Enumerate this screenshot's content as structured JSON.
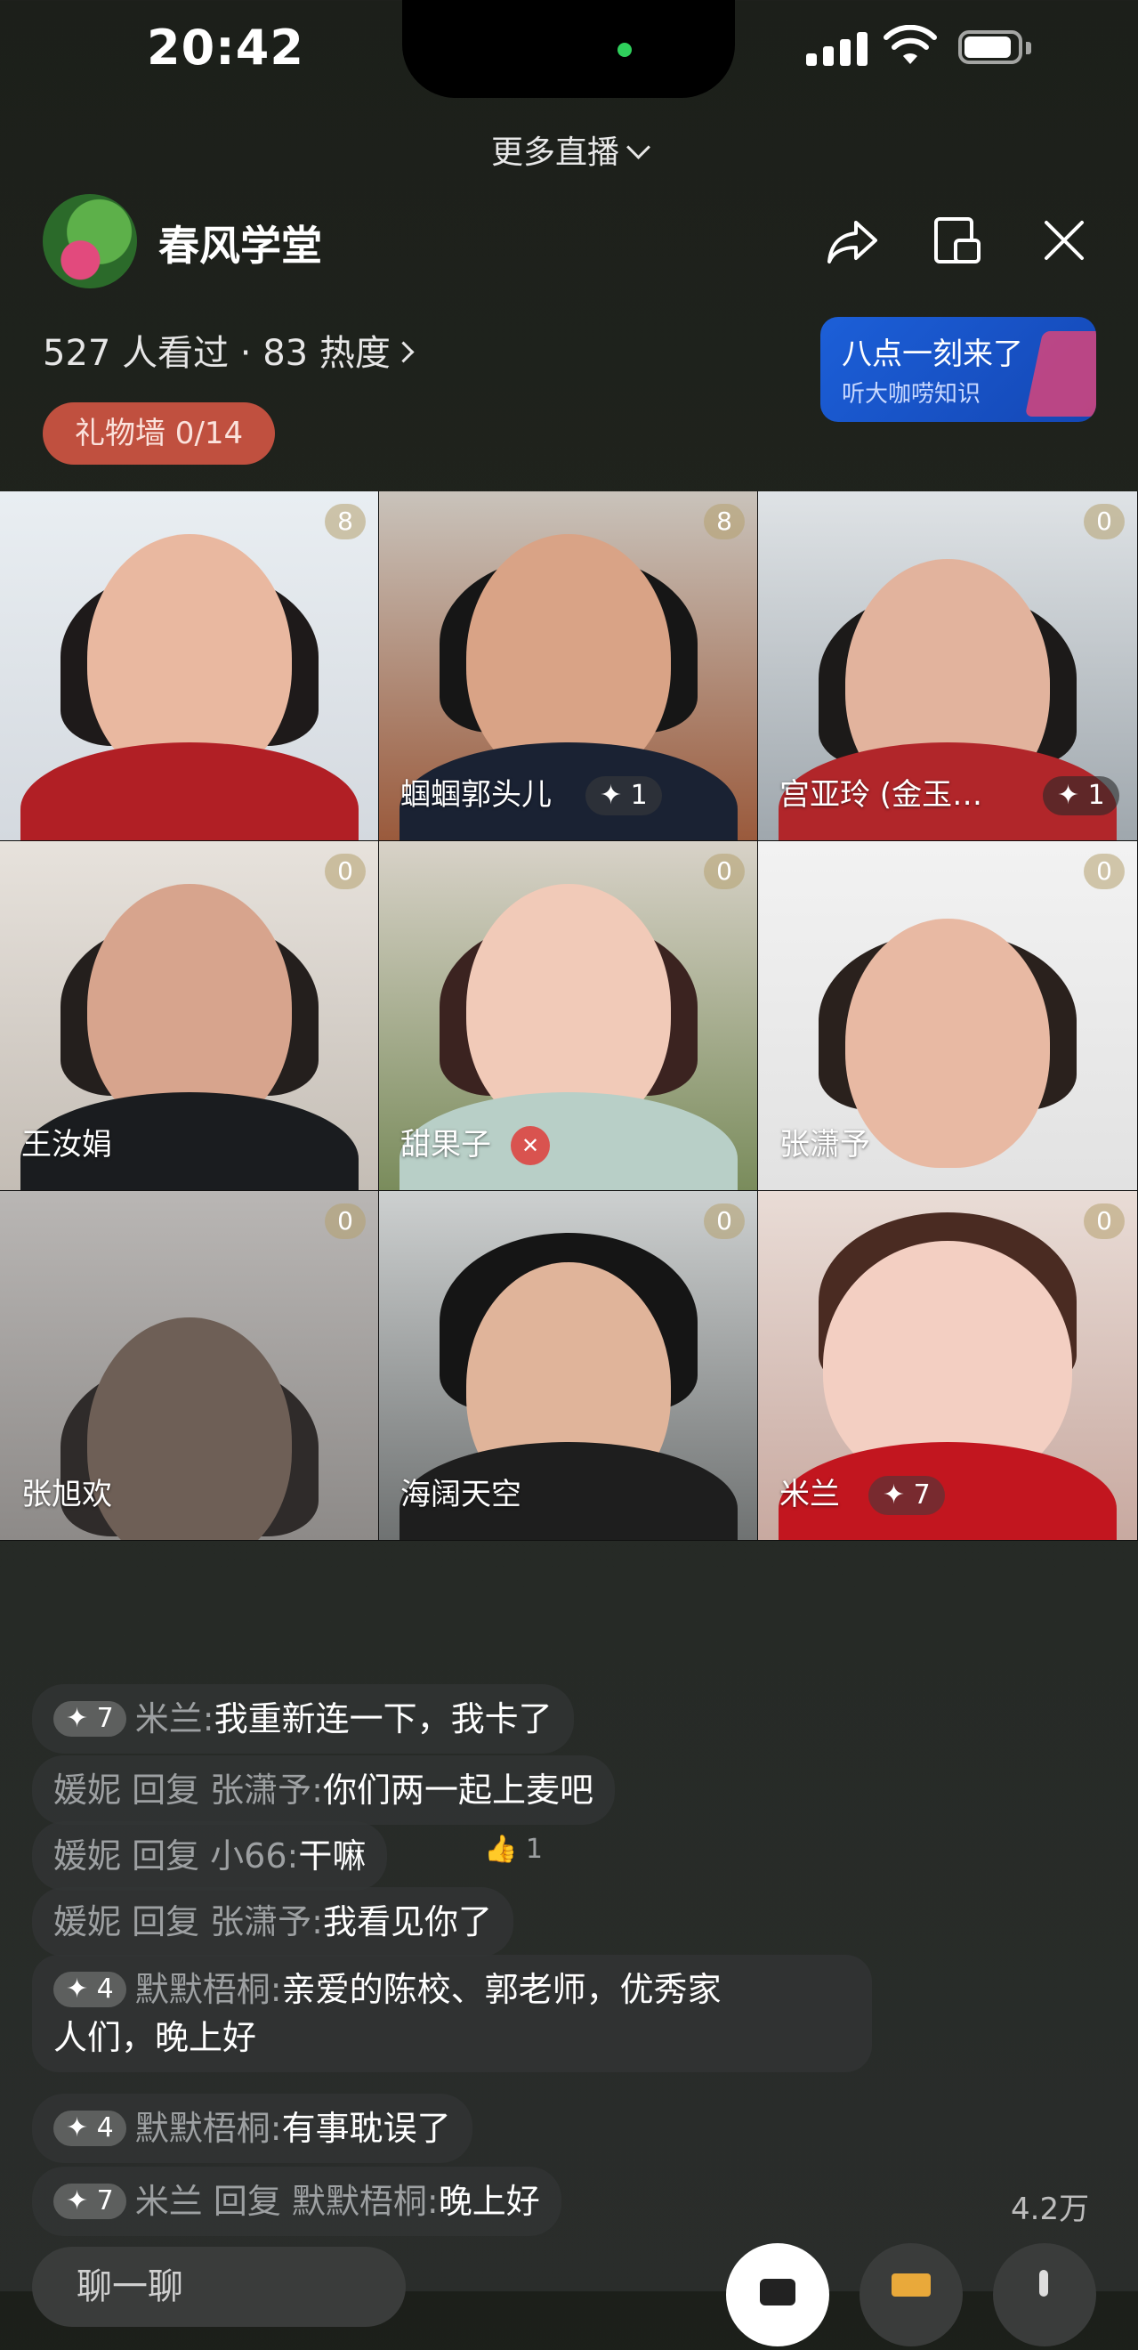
{
  "status_bar": {
    "time": "20:42"
  },
  "header": {
    "more_live": "更多直播",
    "streamer_name": "春风学堂",
    "viewers": "527 人看过 · 83 热度",
    "gift_wall": "礼物墙 0/14",
    "promo": {
      "line1": "八点一刻来了",
      "line2": "听大咖唠知识"
    }
  },
  "grid": {
    "tiles": [
      {
        "name": "",
        "badge": "8",
        "level": ""
      },
      {
        "name": "蝈蝈郭头儿",
        "badge": "8",
        "level": "✦ 1"
      },
      {
        "name": "宫亚玲 (金玉…",
        "badge": "0",
        "level": "✦ 1"
      },
      {
        "name": "王汝娟",
        "badge": "0",
        "level": ""
      },
      {
        "name": "甜果子",
        "badge": "0",
        "level": ""
      },
      {
        "name": "张潇予",
        "badge": "0",
        "level": ""
      },
      {
        "name": "张旭欢",
        "badge": "0",
        "level": ""
      },
      {
        "name": "海阔天空",
        "badge": "0",
        "level": ""
      },
      {
        "name": "米兰",
        "badge": "0",
        "level": "✦ 7"
      }
    ]
  },
  "chat": {
    "messages": [
      {
        "level": "✦ 7",
        "who": "米兰:",
        "text": "我重新连一下，我卡了"
      },
      {
        "level": "",
        "who": "媛妮 回复 张潇予:",
        "text": "你们两一起上麦吧"
      },
      {
        "level": "",
        "who": "媛妮 回复 小66:",
        "text": "干嘛",
        "likes": "1"
      },
      {
        "level": "",
        "who": "媛妮 回复 张潇予:",
        "text": "我看见你了"
      },
      {
        "level": "✦ 4",
        "who": "默默梧桐:",
        "text": "亲爱的陈校、郭老师，优秀家",
        "text2": "人们，晚上好"
      },
      {
        "level": "✦ 4",
        "who": "默默梧桐:",
        "text": "有事耽误了"
      },
      {
        "level": "✦ 7",
        "who": "米兰 回复 默默梧桐:",
        "text": "晚上好"
      }
    ]
  },
  "footer": {
    "like_count": "4.2万",
    "input_placeholder": "聊一聊"
  }
}
